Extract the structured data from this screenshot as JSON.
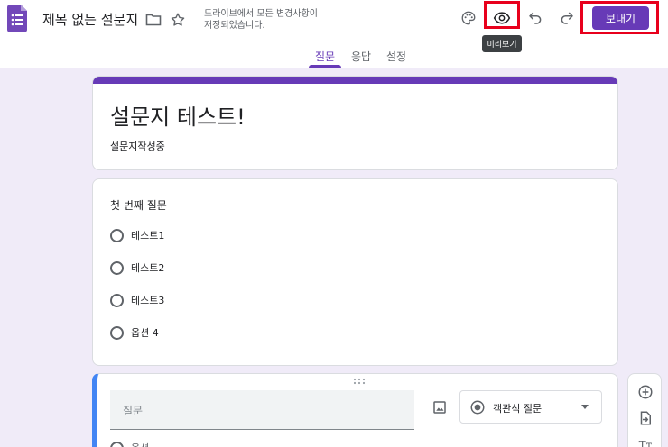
{
  "header": {
    "title": "제목 없는 설문지",
    "save_status": "드라이브에서 모든 변경사항이 저장되었습니다.",
    "tooltip": "미리보기",
    "send_label": "보내기",
    "brand_color": "#673ab7",
    "highlight_color": "#e8001c"
  },
  "tabs": [
    {
      "label": "질문",
      "active": true
    },
    {
      "label": "응답",
      "active": false
    },
    {
      "label": "설정",
      "active": false
    }
  ],
  "form": {
    "title": "설문지 테스트!",
    "description": "설문지작성중"
  },
  "question": {
    "title": "첫 번째 질문",
    "options": [
      "테스트1",
      "테스트2",
      "테스트3",
      "옵션 4"
    ]
  },
  "editor": {
    "question_placeholder": "질문",
    "type_label": "객관식 질문",
    "partial_option": "옵션"
  },
  "side_toolbar": {
    "icons": [
      "add-circle-icon",
      "import-question-icon",
      "title-text-icon"
    ]
  }
}
